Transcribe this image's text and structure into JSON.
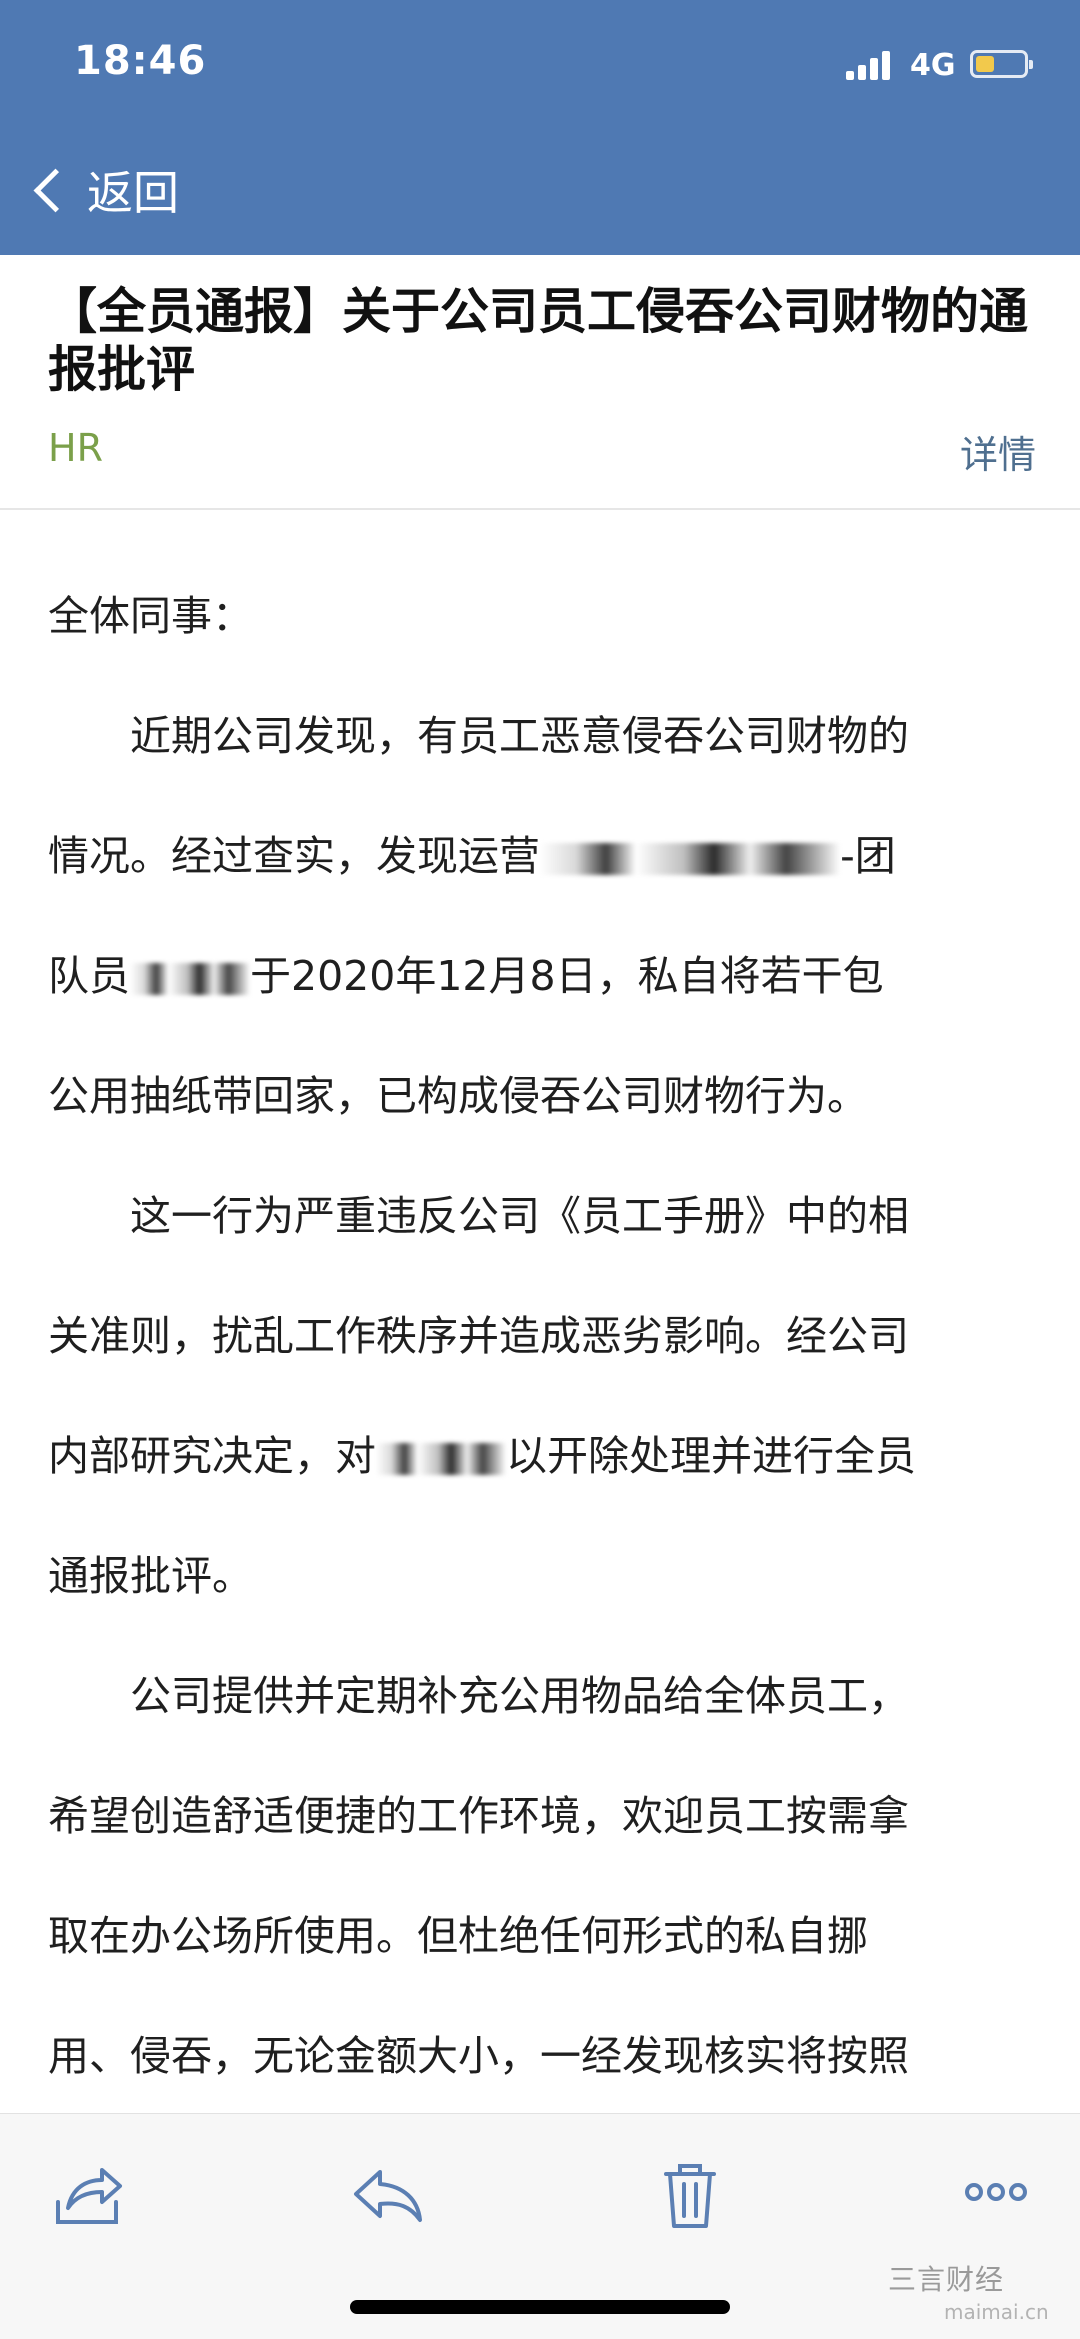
{
  "status_bar": {
    "time": "18:46",
    "network": "4G"
  },
  "nav": {
    "back_label": "返回"
  },
  "email": {
    "title": "【全员通报】关于公司员工侵吞公司财物的通报批评",
    "sender": "HR",
    "details_label": "详情"
  },
  "body": {
    "greeting": "全体同事：",
    "p1_line1": "近期公司发现，有员工恶意侵吞公司财物的",
    "p1_line2_a": "情况。经过查实，发现运营",
    "p1_line2_b": "-团",
    "p1_line3_a": "队员",
    "p1_line3_b": "于2020年12月8日，私自将若干包",
    "p1_line4": "公用抽纸带回家，已构成侵吞公司财物行为。",
    "p2_line1": "这一行为严重违反公司《员工手册》中的相",
    "p2_line2": "关准则，扰乱工作秩序并造成恶劣影响。经公司",
    "p2_line3_a": "内部研究决定，对",
    "p2_line3_b": "以开除处理并进行全员",
    "p2_line4": "通报批评。",
    "p3_line1": "公司提供并定期补充公用物品给全体员工，",
    "p3_line2": "希望创造舒适便捷的工作环境，欢迎员工按需拿",
    "p3_line3": "取在办公场所使用。但杜绝任何形式的私自挪",
    "p3_line4": "用、侵吞，无论金额大小，一经发现核实将按照"
  },
  "toolbar": {
    "icons": [
      "forward-icon",
      "reply-icon",
      "trash-icon",
      "more-icon"
    ]
  },
  "watermark": {
    "text": "三言财经",
    "sub": "maimai.cn"
  },
  "colors": {
    "header_bg": "#4f79b3",
    "sender": "#7ba04a",
    "details": "#4f6f8f",
    "battery": "#f2c94c"
  }
}
